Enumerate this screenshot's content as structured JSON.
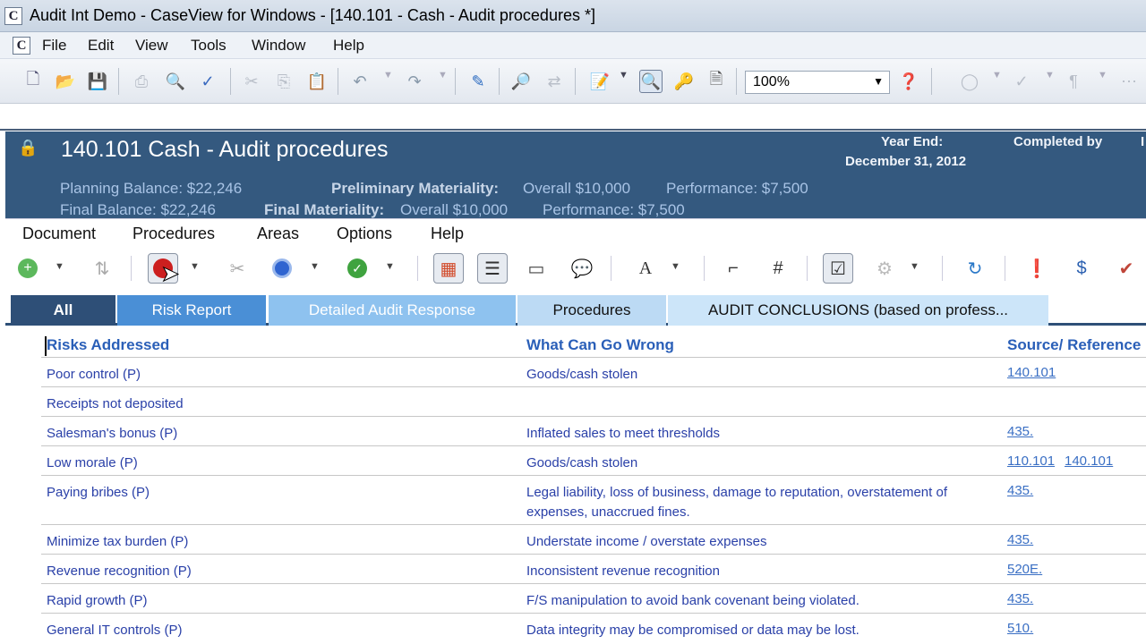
{
  "window": {
    "title": "Audit Int Demo - CaseView for Windows - [140.101 - Cash - Audit procedures *]"
  },
  "app_menu": [
    "File",
    "Edit",
    "View",
    "Tools",
    "Window",
    "Help"
  ],
  "toolbar": {
    "zoom": "100%"
  },
  "header": {
    "title": "140.101 Cash - Audit procedures",
    "year_end_label": "Year End:",
    "year_end_value": "December 31, 2012",
    "completed_by_label": "Completed by",
    "cut_text": "I",
    "planning_balance": "Planning Balance:  $22,246",
    "prelim_materiality_label": "Preliminary Materiality:",
    "prelim_overall": "Overall $10,000",
    "prelim_performance": "Performance: $7,500",
    "final_balance": "Final Balance:  $22,246",
    "final_materiality_label": "Final Materiality:",
    "final_overall": "Overall $10,000",
    "final_performance": "Performance: $7,500"
  },
  "doc_menu": [
    "Document",
    "Procedures",
    "Areas",
    "Options",
    "Help"
  ],
  "tabs": [
    "All",
    "Risk Report",
    "Detailed Audit Response",
    "Procedures",
    "AUDIT CONCLUSIONS (based on profess..."
  ],
  "table": {
    "headers": {
      "risk": "Risks Addressed",
      "wrong": "What Can Go Wrong",
      "source": "Source/  Reference"
    },
    "rows": [
      {
        "risk": "Poor control (P)",
        "wrong": "Goods/cash stolen",
        "refs": [
          "140.101"
        ]
      },
      {
        "risk": "Receipts not deposited",
        "wrong": "",
        "refs": []
      },
      {
        "risk": "Salesman's bonus (P)",
        "wrong": "Inflated sales to meet thresholds",
        "refs": [
          "435."
        ]
      },
      {
        "risk": "Low morale (P)",
        "wrong": "Goods/cash stolen",
        "refs": [
          "110.101",
          "140.101"
        ]
      },
      {
        "risk": "Paying bribes (P)",
        "wrong": "Legal liability, loss of business, damage to reputation, overstatement of expenses, unaccrued fines.",
        "refs": [
          "435."
        ]
      },
      {
        "risk": "Minimize tax burden (P)",
        "wrong": "Understate income / overstate expenses",
        "refs": [
          "435."
        ]
      },
      {
        "risk": "Revenue recognition (P)",
        "wrong": "Inconsistent revenue recognition",
        "refs": [
          "520E."
        ]
      },
      {
        "risk": "Rapid growth (P)",
        "wrong": "F/S manipulation to avoid bank covenant being violated.",
        "refs": [
          "435."
        ]
      },
      {
        "risk": "General IT controls (P)",
        "wrong": "Data integrity may be compromised or data may be lost.",
        "refs": [
          "510."
        ]
      }
    ]
  }
}
